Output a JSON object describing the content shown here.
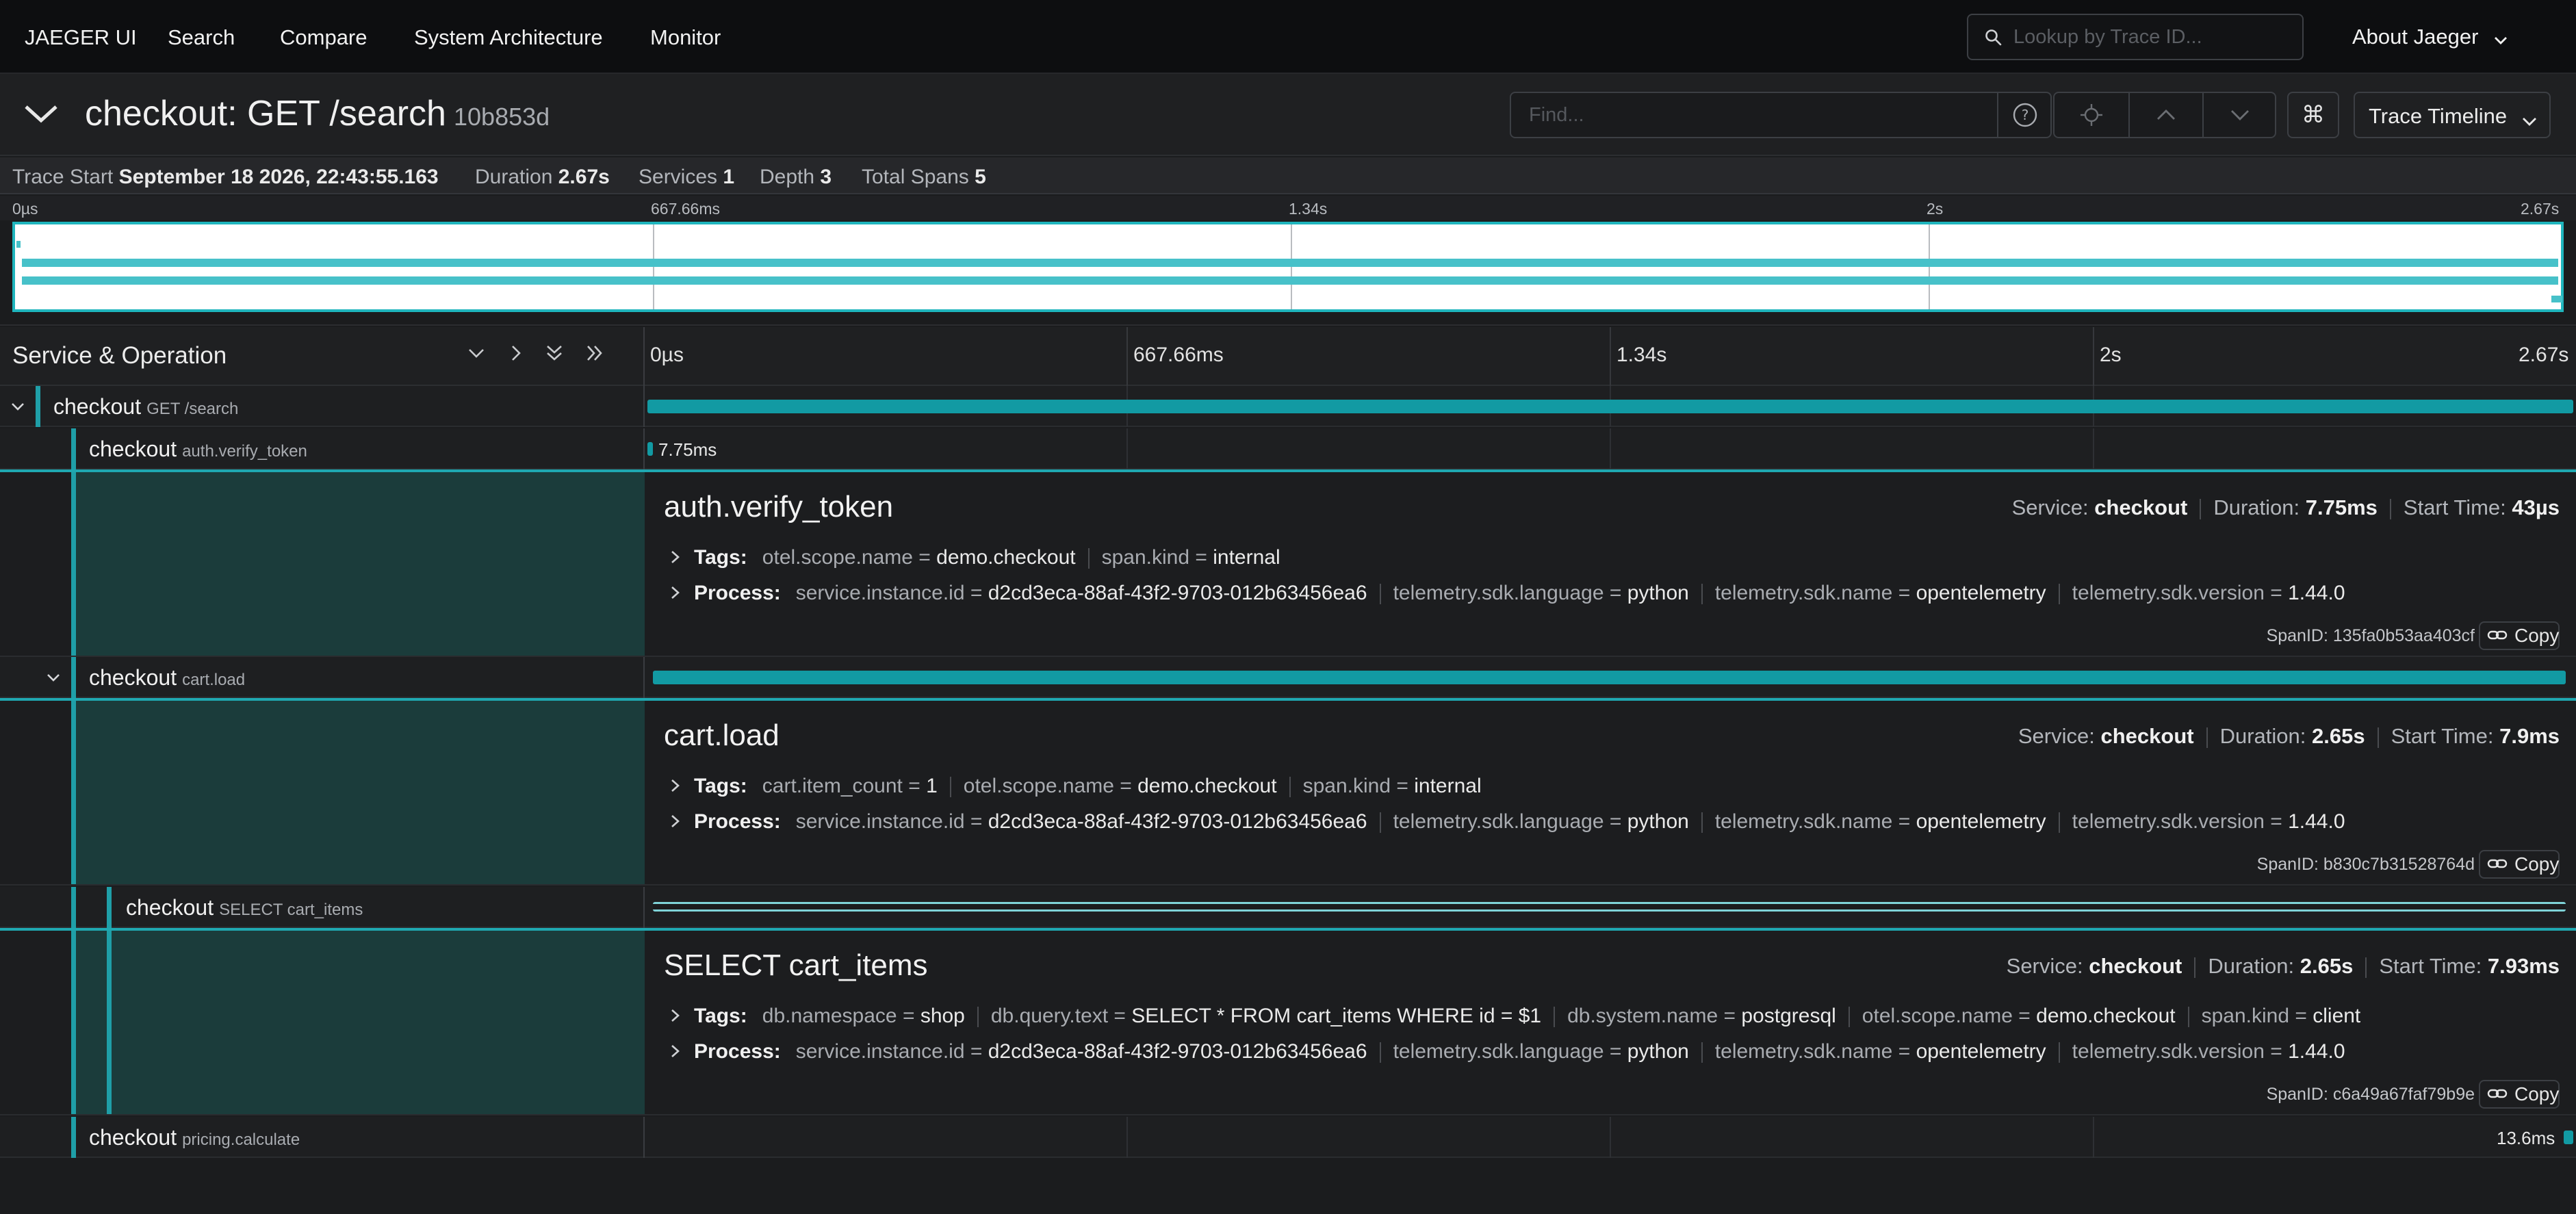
{
  "nav": {
    "brand": "JAEGER UI",
    "items": [
      "Search",
      "Compare",
      "System Architecture",
      "Monitor"
    ],
    "lookup_placeholder": "Lookup by Trace ID...",
    "about": "About Jaeger"
  },
  "trace": {
    "title": "checkout: GET /search",
    "id": "10b853d",
    "find_placeholder": "Find...",
    "cmd_symbol": "⌘",
    "view": "Trace Timeline"
  },
  "stats": {
    "start_label": "Trace Start",
    "start_value": "September 18 2026, 22:43:55.163",
    "duration_label": "Duration",
    "duration_value": "2.67s",
    "services_label": "Services",
    "services_value": "1",
    "depth_label": "Depth",
    "depth_value": "3",
    "spans_label": "Total Spans",
    "spans_value": "5"
  },
  "minimap": {
    "ticks": [
      "0µs",
      "667.66ms",
      "1.34s",
      "2s",
      "2.67s"
    ]
  },
  "timeline": {
    "header": "Service & Operation",
    "ticks": [
      "0µs",
      "667.66ms",
      "1.34s",
      "2s",
      "2.67s"
    ]
  },
  "spans": [
    {
      "service": "checkout",
      "operation": "GET /search",
      "duration_label": "",
      "start_frac": 0.0,
      "width_frac": 1.0
    },
    {
      "service": "checkout",
      "operation": "auth.verify_token",
      "duration_label": "7.75ms",
      "start_frac": 0.0,
      "width_frac": 0.003
    },
    {
      "service": "checkout",
      "operation": "cart.load",
      "duration_label": "",
      "start_frac": 0.003,
      "width_frac": 0.993
    },
    {
      "service": "checkout",
      "operation": "SELECT cart_items",
      "duration_label": "",
      "start_frac": 0.003,
      "width_frac": 0.993
    },
    {
      "service": "checkout",
      "operation": "pricing.calculate",
      "duration_label": "13.6ms",
      "start_frac": 0.995,
      "width_frac": 0.005
    }
  ],
  "details": [
    {
      "title": "auth.verify_token",
      "service_label": "Service:",
      "service": "checkout",
      "duration_label": "Duration:",
      "duration": "7.75ms",
      "start_label": "Start Time:",
      "start": "43µs",
      "tags_label": "Tags:",
      "tags": [
        {
          "k": "otel.scope.name",
          "v": "demo.checkout"
        },
        {
          "k": "span.kind",
          "v": "internal"
        }
      ],
      "process_label": "Process:",
      "process": [
        {
          "k": "service.instance.id",
          "v": "d2cd3eca-88af-43f2-9703-012b63456ea6"
        },
        {
          "k": "telemetry.sdk.language",
          "v": "python"
        },
        {
          "k": "telemetry.sdk.name",
          "v": "opentelemetry"
        },
        {
          "k": "telemetry.sdk.version",
          "v": "1.44.0"
        }
      ],
      "span_id": "SpanID: 135fa0b53aa403cf",
      "copy": "Copy"
    },
    {
      "title": "cart.load",
      "service_label": "Service:",
      "service": "checkout",
      "duration_label": "Duration:",
      "duration": "2.65s",
      "start_label": "Start Time:",
      "start": "7.9ms",
      "tags_label": "Tags:",
      "tags": [
        {
          "k": "cart.item_count",
          "v": "1"
        },
        {
          "k": "otel.scope.name",
          "v": "demo.checkout"
        },
        {
          "k": "span.kind",
          "v": "internal"
        }
      ],
      "process_label": "Process:",
      "process": [
        {
          "k": "service.instance.id",
          "v": "d2cd3eca-88af-43f2-9703-012b63456ea6"
        },
        {
          "k": "telemetry.sdk.language",
          "v": "python"
        },
        {
          "k": "telemetry.sdk.name",
          "v": "opentelemetry"
        },
        {
          "k": "telemetry.sdk.version",
          "v": "1.44.0"
        }
      ],
      "span_id": "SpanID: b830c7b31528764d",
      "copy": "Copy"
    },
    {
      "title": "SELECT cart_items",
      "service_label": "Service:",
      "service": "checkout",
      "duration_label": "Duration:",
      "duration": "2.65s",
      "start_label": "Start Time:",
      "start": "7.93ms",
      "tags_label": "Tags:",
      "tags": [
        {
          "k": "db.namespace",
          "v": "shop"
        },
        {
          "k": "db.query.text",
          "v": "SELECT * FROM cart_items WHERE id = $1"
        },
        {
          "k": "db.system.name",
          "v": "postgresql"
        },
        {
          "k": "otel.scope.name",
          "v": "demo.checkout"
        },
        {
          "k": "span.kind",
          "v": "client"
        }
      ],
      "process_label": "Process:",
      "process": [
        {
          "k": "service.instance.id",
          "v": "d2cd3eca-88af-43f2-9703-012b63456ea6"
        },
        {
          "k": "telemetry.sdk.language",
          "v": "python"
        },
        {
          "k": "telemetry.sdk.name",
          "v": "opentelemetry"
        },
        {
          "k": "telemetry.sdk.version",
          "v": "1.44.0"
        }
      ],
      "span_id": "SpanID: c6a49a67faf79b9e",
      "copy": "Copy"
    }
  ],
  "colors": {
    "accent": "#1fa8b1",
    "span_bar": "#129aa3",
    "detail_left": "#1b3c3b"
  }
}
